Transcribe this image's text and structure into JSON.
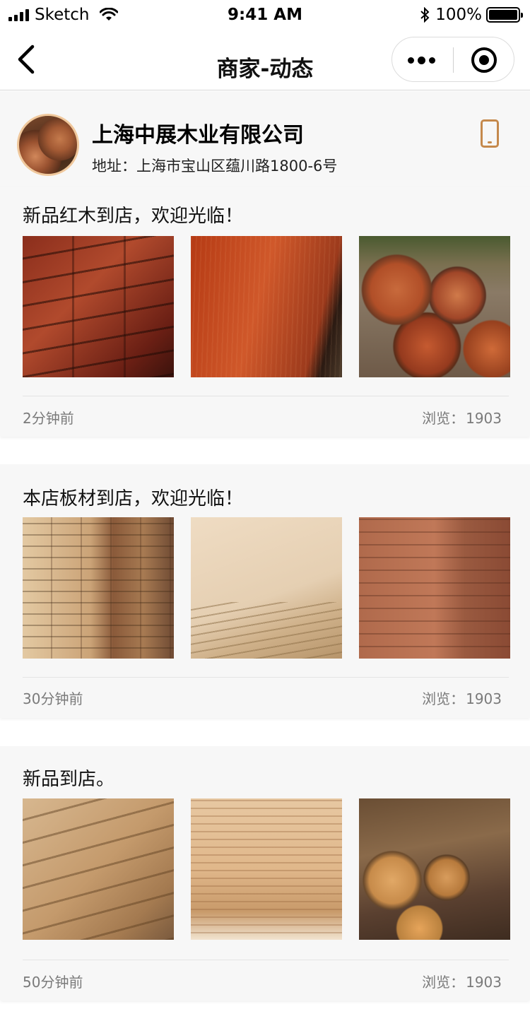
{
  "status_bar": {
    "carrier": "Sketch",
    "time": "9:41 AM",
    "battery": "100%"
  },
  "nav": {
    "title": "商家-动态"
  },
  "shop": {
    "name": "上海中展木业有限公司",
    "address": "地址：上海市宝山区蕴川路1800-6号"
  },
  "posts": [
    {
      "text": "新品红木到店，欢迎光临！",
      "time": "2分钟前",
      "views_label": "浏览：",
      "views": "1903",
      "images": [
        "red-timber-stack",
        "red-wood-board",
        "red-log-pile"
      ]
    },
    {
      "text": "本店板材到店，欢迎光临！",
      "time": "30分钟前",
      "views_label": "浏览：",
      "views": "1903",
      "images": [
        "lumber-yard-stack",
        "plywood-sheets",
        "red-plank-stack"
      ]
    },
    {
      "text": "新品到店。",
      "time": "50分钟前",
      "views_label": "浏览：",
      "views": "1903",
      "images": [
        "square-beam-stack",
        "pale-board-stack",
        "round-log-pile"
      ]
    }
  ]
}
